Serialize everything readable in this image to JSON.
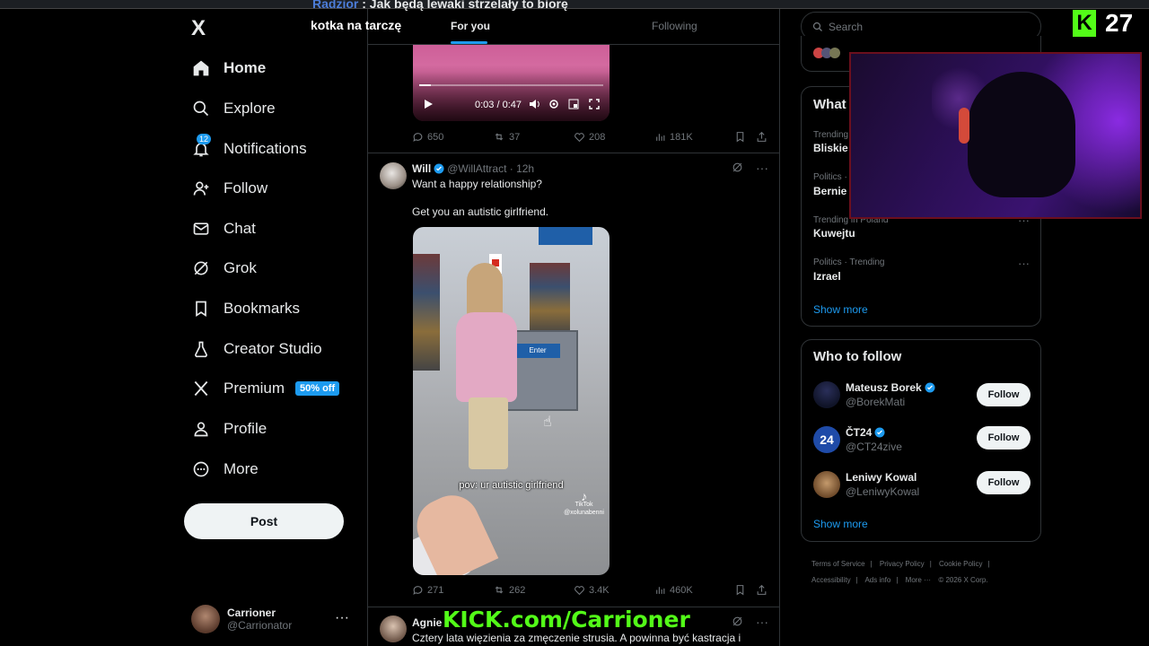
{
  "overlay": {
    "chat_user": "Radzior",
    "chat_message": ": Jak będą lewaki strzelały to biorę",
    "chat_message_2": "kotka na tarczę",
    "viewer_count": "27",
    "kick_logo": "K",
    "kick_url": "KICK.com/Carrioner"
  },
  "sidebar": {
    "logo": "X",
    "items": [
      {
        "label": "Home",
        "icon": "home-icon"
      },
      {
        "label": "Explore",
        "icon": "search-icon"
      },
      {
        "label": "Notifications",
        "icon": "bell-icon",
        "badge": "12"
      },
      {
        "label": "Follow",
        "icon": "person-add-icon"
      },
      {
        "label": "Chat",
        "icon": "envelope-icon"
      },
      {
        "label": "Grok",
        "icon": "grok-icon"
      },
      {
        "label": "Bookmarks",
        "icon": "bookmark-icon"
      },
      {
        "label": "Creator Studio",
        "icon": "flask-icon"
      },
      {
        "label": "Premium",
        "icon": "x-icon",
        "badge": "50% off"
      },
      {
        "label": "Profile",
        "icon": "person-icon"
      },
      {
        "label": "More",
        "icon": "more-circle-icon"
      }
    ],
    "post_label": "Post",
    "account": {
      "name": "Carrioner",
      "handle": "@Carrionator",
      "menu": "···"
    }
  },
  "main": {
    "tabs": [
      "For you",
      "Following"
    ],
    "tweet1": {
      "video_time": "0:03 / 0:47",
      "video_progress": 0.064,
      "replies": "650",
      "reposts": "37",
      "likes": "208",
      "views": "181K"
    },
    "tweet2": {
      "name": "Will",
      "handle": "@WillAttract · 12h",
      "text_line1": "Want a happy relationship?",
      "text_line2": "Get you an autistic girlfriend.",
      "video_caption": "pov: ur autistic girlfriend",
      "video_watermark": "TikTok",
      "video_watermark_handle": "@xolunabenni",
      "store_sign": "Enter",
      "replies": "271",
      "reposts": "262",
      "likes": "3.4K",
      "views": "460K"
    },
    "tweet3": {
      "name": "Agnie",
      "text": "Cztery lata więzienia za zmęczenie strusia. A powinna być kastracja i"
    }
  },
  "right": {
    "search_placeholder": "Search",
    "trends_title": "What",
    "trends": [
      {
        "meta": "Trending",
        "name": "Bliskie"
      },
      {
        "meta": "Politics ·",
        "name": "Bernie"
      },
      {
        "meta": "Trending in Poland",
        "name": "Kuwejtu"
      },
      {
        "meta": "Politics · Trending",
        "name": "Izrael"
      }
    ],
    "trends_show_more": "Show more",
    "wtf_title": "Who to follow",
    "wtf": [
      {
        "name": "Mateusz Borek",
        "handle": "@BorekMati",
        "button": "Follow"
      },
      {
        "name": "ČT24",
        "handle": "@CT24zive",
        "button": "Follow"
      },
      {
        "name": "Leniwy Kowal",
        "handle": "@LeniwyKowal",
        "button": "Follow"
      }
    ],
    "wtf_show_more": "Show more",
    "footer": [
      "Terms of Service",
      "|",
      "Privacy Policy",
      "|",
      "Cookie Policy",
      "|",
      "Accessibility",
      "|",
      "Ads info",
      "|",
      "More ···",
      "© 2026 X Corp."
    ]
  }
}
